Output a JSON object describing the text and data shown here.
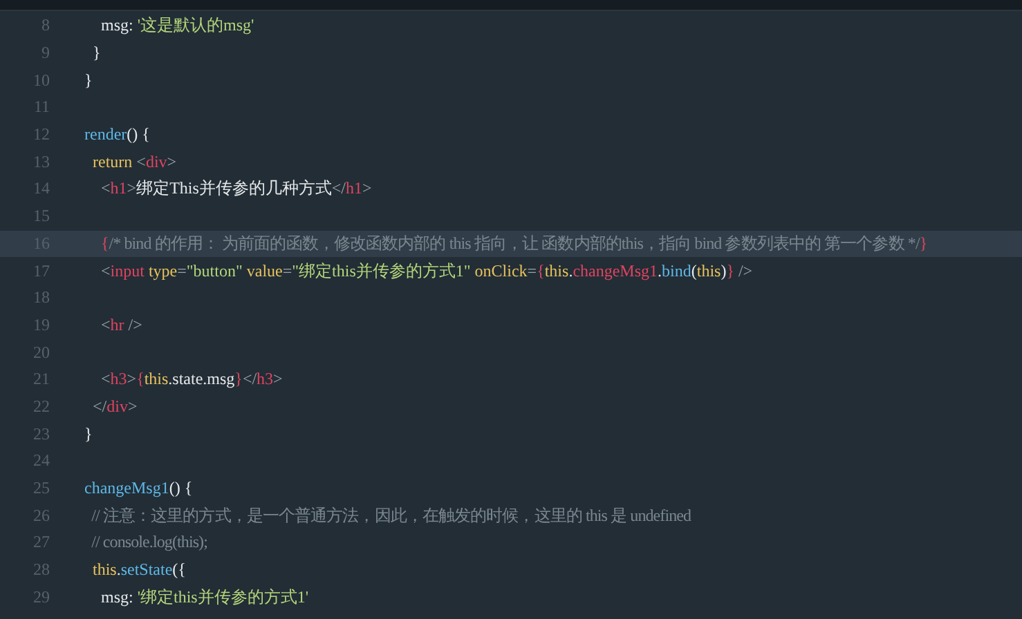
{
  "lines": [
    {
      "number": "8",
      "current": false,
      "tokens": [
        {
          "kind": "plain",
          "text": "    msg: "
        },
        {
          "kind": "string",
          "text": "'这是默认的msg'"
        }
      ]
    },
    {
      "number": "9",
      "current": false,
      "tokens": [
        {
          "kind": "plain",
          "text": "  }"
        }
      ]
    },
    {
      "number": "10",
      "current": false,
      "tokens": [
        {
          "kind": "plain",
          "text": "}"
        }
      ]
    },
    {
      "number": "11",
      "current": false
    },
    {
      "number": "12",
      "current": false,
      "tokens": [
        {
          "kind": "func",
          "text": "render"
        },
        {
          "kind": "plain",
          "text": "() {"
        }
      ]
    },
    {
      "number": "13",
      "current": false,
      "tokens": [
        {
          "kind": "keyword",
          "text": "  return "
        },
        {
          "kind": "punct",
          "text": "<"
        },
        {
          "kind": "tag",
          "text": "div"
        },
        {
          "kind": "punct",
          "text": ">"
        }
      ]
    },
    {
      "number": "14",
      "current": false,
      "tokens": [
        {
          "kind": "punct",
          "text": "    <"
        },
        {
          "kind": "tag",
          "text": "h1"
        },
        {
          "kind": "punct",
          "text": ">"
        },
        {
          "kind": "plain",
          "text": "绑定This并传参的几种方式"
        },
        {
          "kind": "punct",
          "text": "</"
        },
        {
          "kind": "tag",
          "text": "h1"
        },
        {
          "kind": "punct",
          "text": ">"
        }
      ]
    },
    {
      "number": "15",
      "current": false
    },
    {
      "number": "16",
      "current": true,
      "tokens": [
        {
          "kind": "brace",
          "text": "    {"
        },
        {
          "kind": "comment",
          "text": "/* bind 的作用： 为前面的函数，修改函数内部的 this 指向，让 函数内部的this，指向 bind 参数列表中的 第一个参数 */"
        },
        {
          "kind": "brace",
          "text": "}"
        }
      ]
    },
    {
      "number": "17",
      "current": false,
      "tokens": [
        {
          "kind": "punct",
          "text": "    <"
        },
        {
          "kind": "tag",
          "text": "input"
        },
        {
          "kind": "attr",
          "text": " type"
        },
        {
          "kind": "punct",
          "text": "="
        },
        {
          "kind": "string",
          "text": "\"button\""
        },
        {
          "kind": "attr",
          "text": " value"
        },
        {
          "kind": "punct",
          "text": "="
        },
        {
          "kind": "string",
          "text": "\"绑定this并传参的方式1\""
        },
        {
          "kind": "attr",
          "text": " onClick"
        },
        {
          "kind": "punct",
          "text": "="
        },
        {
          "kind": "brace",
          "text": "{"
        },
        {
          "kind": "keyword",
          "text": "this"
        },
        {
          "kind": "plain",
          "text": "."
        },
        {
          "kind": "method",
          "text": "changeMsg1"
        },
        {
          "kind": "plain",
          "text": "."
        },
        {
          "kind": "func",
          "text": "bind"
        },
        {
          "kind": "plain",
          "text": "("
        },
        {
          "kind": "keyword",
          "text": "this"
        },
        {
          "kind": "plain",
          "text": ")"
        },
        {
          "kind": "brace",
          "text": "}"
        },
        {
          "kind": "punct",
          "text": " />"
        }
      ]
    },
    {
      "number": "18",
      "current": false
    },
    {
      "number": "19",
      "current": false,
      "tokens": [
        {
          "kind": "punct",
          "text": "    <"
        },
        {
          "kind": "tag",
          "text": "hr"
        },
        {
          "kind": "punct",
          "text": " />"
        }
      ]
    },
    {
      "number": "20",
      "current": false
    },
    {
      "number": "21",
      "current": false,
      "tokens": [
        {
          "kind": "punct",
          "text": "    <"
        },
        {
          "kind": "tag",
          "text": "h3"
        },
        {
          "kind": "punct",
          "text": ">"
        },
        {
          "kind": "brace",
          "text": "{"
        },
        {
          "kind": "keyword",
          "text": "this"
        },
        {
          "kind": "plain",
          "text": ".state.msg"
        },
        {
          "kind": "brace",
          "text": "}"
        },
        {
          "kind": "punct",
          "text": "</"
        },
        {
          "kind": "tag",
          "text": "h3"
        },
        {
          "kind": "punct",
          "text": ">"
        }
      ]
    },
    {
      "number": "22",
      "current": false,
      "tokens": [
        {
          "kind": "punct",
          "text": "  </"
        },
        {
          "kind": "tag",
          "text": "div"
        },
        {
          "kind": "punct",
          "text": ">"
        }
      ]
    },
    {
      "number": "23",
      "current": false,
      "tokens": [
        {
          "kind": "plain",
          "text": "}"
        }
      ]
    },
    {
      "number": "24",
      "current": false
    },
    {
      "number": "25",
      "current": false,
      "tokens": [
        {
          "kind": "func",
          "text": "changeMsg1"
        },
        {
          "kind": "plain",
          "text": "() {"
        }
      ]
    },
    {
      "number": "26",
      "current": false,
      "tokens": [
        {
          "kind": "comment",
          "text": "  // 注意：这里的方式，是一个普通方法，因此，在触发的时候，这里的 this 是 undefined"
        }
      ]
    },
    {
      "number": "27",
      "current": false,
      "tokens": [
        {
          "kind": "comment",
          "text": "  // console.log(this);"
        }
      ]
    },
    {
      "number": "28",
      "current": false,
      "tokens": [
        {
          "kind": "keyword",
          "text": "  this"
        },
        {
          "kind": "plain",
          "text": "."
        },
        {
          "kind": "func",
          "text": "setState"
        },
        {
          "kind": "plain",
          "text": "({"
        }
      ]
    },
    {
      "number": "29",
      "current": false,
      "tokens": [
        {
          "kind": "plain",
          "text": "    msg: "
        },
        {
          "kind": "string",
          "text": "'绑定this并传参的方式1'"
        }
      ]
    }
  ]
}
